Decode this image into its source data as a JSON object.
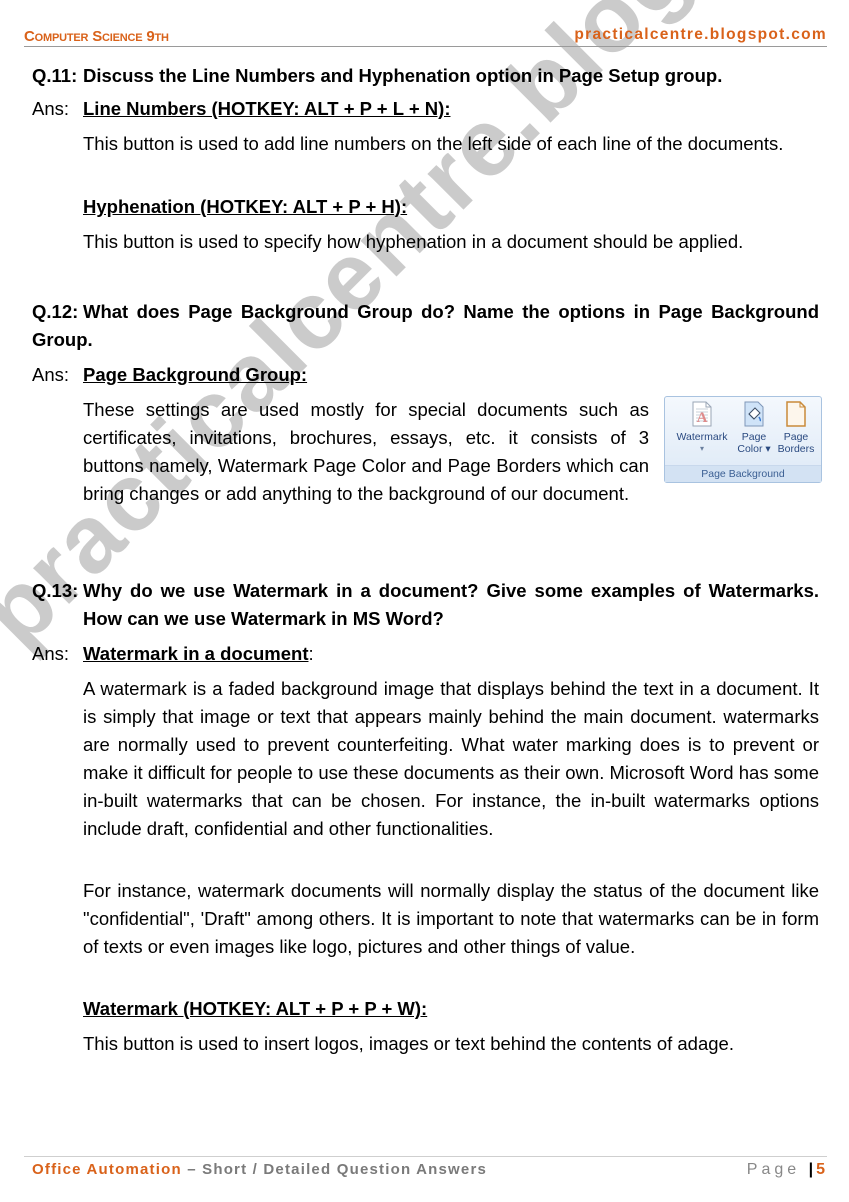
{
  "header": {
    "left_title": "Computer Science 9th",
    "right_site": "practicalcentre.blogspot.com"
  },
  "watermark": {
    "text": "practicalcentre.blogspot.com"
  },
  "q11": {
    "number": "Q.11:",
    "question": "Discuss the Line Numbers and Hyphenation option in Page Setup group.",
    "ans_label": "Ans:",
    "sections": [
      {
        "heading": "Line Numbers (HOTKEY: ALT + P + L + N):",
        "text": "This button is used to add line numbers on the left side of each line of the documents."
      },
      {
        "heading": "Hyphenation (HOTKEY: ALT + P + H):",
        "text": "This button is used to specify how hyphenation in a document should be applied."
      }
    ]
  },
  "q12": {
    "number": "Q.12:",
    "question": "What does Page Background Group do? Name the options in Page Background Group.",
    "ans_label": "Ans:",
    "heading": "Page Background Group:",
    "text": "These settings are used mostly for special documents such as certificates, invitations, brochures, essays, etc. it consists of 3 buttons namely, Watermark Page Color and Page Borders which can bring changes or add anything to the background of our document.",
    "ribbon": {
      "group_label": "Page Background",
      "buttons": [
        {
          "line1": "Watermark",
          "line2": "▾",
          "icon": "watermark-icon"
        },
        {
          "line1": "Page",
          "line2": "Color ▾",
          "icon": "page-color-icon"
        },
        {
          "line1": "Page",
          "line2": "Borders",
          "icon": "page-borders-icon"
        }
      ]
    }
  },
  "q13": {
    "number": "Q.13:",
    "question": "Why do we use Watermark in a document? Give some examples of Watermarks. How can we use Watermark in MS Word?",
    "ans_label": "Ans:",
    "heading1": "Watermark in a document",
    "heading1_suffix": ":",
    "para1": "A watermark is a faded background image that displays behind the text in a document. It is simply that image or text that appears mainly behind the main document. watermarks are normally used to prevent counterfeiting. What water marking does is to prevent or make it difficult for people to use these documents as their own. Microsoft Word has some in-built watermarks that can be chosen. For instance, the in-built watermarks options include draft, confidential and other functionalities.",
    "para2": "For instance, watermark documents will normally display the status of the document like \"confidential\", 'Draft\" among others. It is important to note that watermarks can be in form of texts or even images like logo, pictures and other things of value.",
    "heading2": "Watermark (HOTKEY: ALT + P + P + W):",
    "para3": "This button is used to insert logos, images or text behind the contents of adage."
  },
  "footer": {
    "subject": "Office Automation",
    "dash": " – ",
    "subtitle": "Short / Detailed Question Answers",
    "page_label": "Page",
    "page_sep": "|",
    "page_number": "5"
  },
  "colors": {
    "accent": "#d9621a",
    "watermark": "#a0a0a0",
    "ribbon_text": "#2a4a80"
  }
}
